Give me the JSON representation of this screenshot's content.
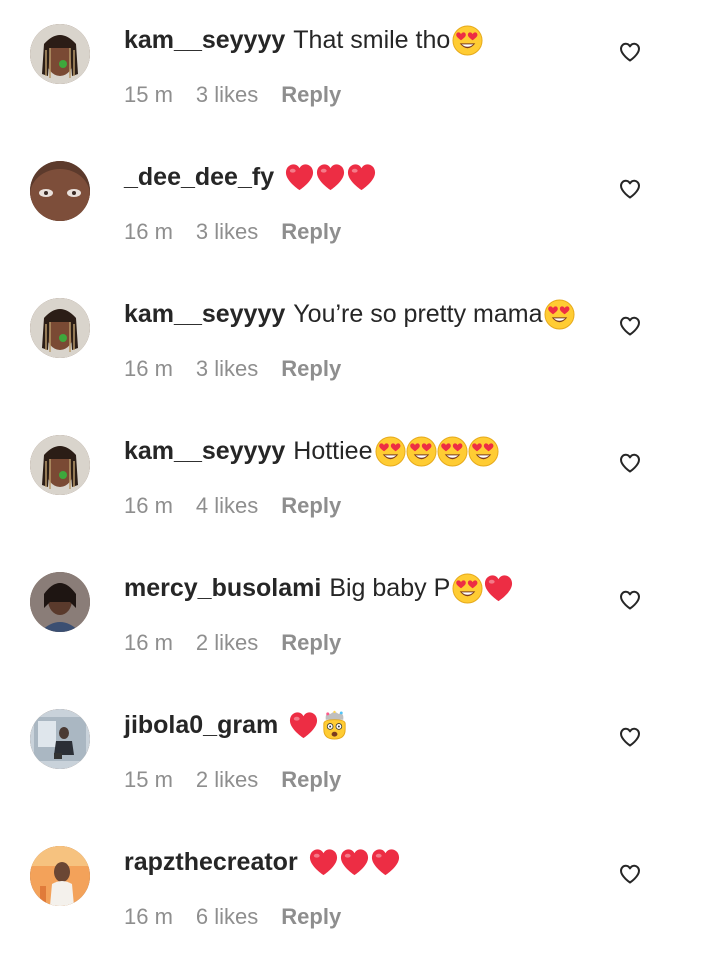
{
  "comments": [
    {
      "username": "kam__seyyyy",
      "text": "That smile tho",
      "emojis": [
        "heart-eyes"
      ],
      "time": "15 m",
      "likes": "3 likes",
      "reply": "Reply",
      "avatar": "braids-avatar"
    },
    {
      "username": "_dee_dee_fy",
      "text": "",
      "emojis": [
        "red-heart",
        "red-heart",
        "red-heart"
      ],
      "time": "16 m",
      "likes": "3 likes",
      "reply": "Reply",
      "avatar": "closeup-avatar"
    },
    {
      "username": "kam__seyyyy",
      "text": "You’re so pretty mama",
      "emojis": [
        "heart-eyes"
      ],
      "time": "16 m",
      "likes": "3 likes",
      "reply": "Reply",
      "avatar": "braids-avatar"
    },
    {
      "username": "kam__seyyyy",
      "text": "Hottiee ",
      "emojis": [
        "heart-eyes",
        "heart-eyes",
        "heart-eyes",
        "heart-eyes"
      ],
      "time": "16 m",
      "likes": "4 likes",
      "reply": "Reply",
      "avatar": "braids-avatar"
    },
    {
      "username": "mercy_busolami",
      "text": "Big baby P",
      "emojis": [
        "heart-eyes",
        "red-heart"
      ],
      "time": "16 m",
      "likes": "2 likes",
      "reply": "Reply",
      "avatar": "portrait-avatar"
    },
    {
      "username": "jibola0_gram",
      "text": "",
      "emojis": [
        "red-heart",
        "exploding-head"
      ],
      "time": "15 m",
      "likes": "2 likes",
      "reply": "Reply",
      "avatar": "photo-avatar"
    },
    {
      "username": "rapzthecreator",
      "text": "",
      "emojis": [
        "red-heart",
        "red-heart",
        "red-heart"
      ],
      "time": "16 m",
      "likes": "6 likes",
      "reply": "Reply",
      "avatar": "orange-avatar"
    }
  ],
  "colors": {
    "username": "#262626",
    "meta": "#8e8e8e",
    "heart": "#ed2d44",
    "emoji_face": "#ffcc33"
  }
}
